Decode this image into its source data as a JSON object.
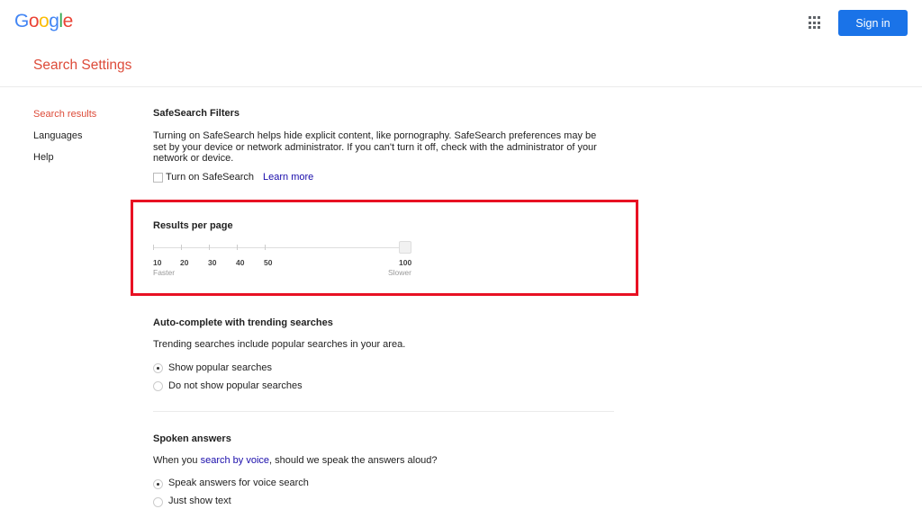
{
  "header": {
    "logo_letters": [
      {
        "char": "G",
        "color": "#4285f4"
      },
      {
        "char": "o",
        "color": "#ea4335"
      },
      {
        "char": "o",
        "color": "#fbbc05"
      },
      {
        "char": "g",
        "color": "#4285f4"
      },
      {
        "char": "l",
        "color": "#34a853"
      },
      {
        "char": "e",
        "color": "#ea4335"
      }
    ],
    "apps_icon": "apps-grid-icon",
    "sign_in_label": "Sign in",
    "page_title": "Search Settings"
  },
  "sidebar": {
    "items": [
      {
        "label": "Search results",
        "active": true
      },
      {
        "label": "Languages",
        "active": false
      },
      {
        "label": "Help",
        "active": false
      }
    ]
  },
  "safesearch": {
    "title": "SafeSearch Filters",
    "description": "Turning on SafeSearch helps hide explicit content, like pornography. SafeSearch preferences may be set by your device or network administrator. If you can't turn it off, check with the administrator of your network or device.",
    "checkbox_label": "Turn on SafeSearch",
    "checked": false,
    "learn_more": "Learn more"
  },
  "results_per_page": {
    "title": "Results per page",
    "options": [
      "10",
      "20",
      "30",
      "40",
      "50",
      "100"
    ],
    "selected": "100",
    "left_caption": "Faster",
    "right_caption": "Slower"
  },
  "autocomplete": {
    "title": "Auto-complete with trending searches",
    "description": "Trending searches include popular searches in your area.",
    "options": [
      {
        "label": "Show popular searches",
        "checked": true
      },
      {
        "label": "Do not show popular searches",
        "checked": false
      }
    ]
  },
  "spoken": {
    "title": "Spoken answers",
    "description_prefix": "When you ",
    "description_link": "search by voice",
    "description_suffix": ", should we speak the answers aloud?",
    "options": [
      {
        "label": "Speak answers for voice search",
        "checked": true
      },
      {
        "label": "Just show text",
        "checked": false
      }
    ]
  },
  "highlight_color": "#e81123"
}
